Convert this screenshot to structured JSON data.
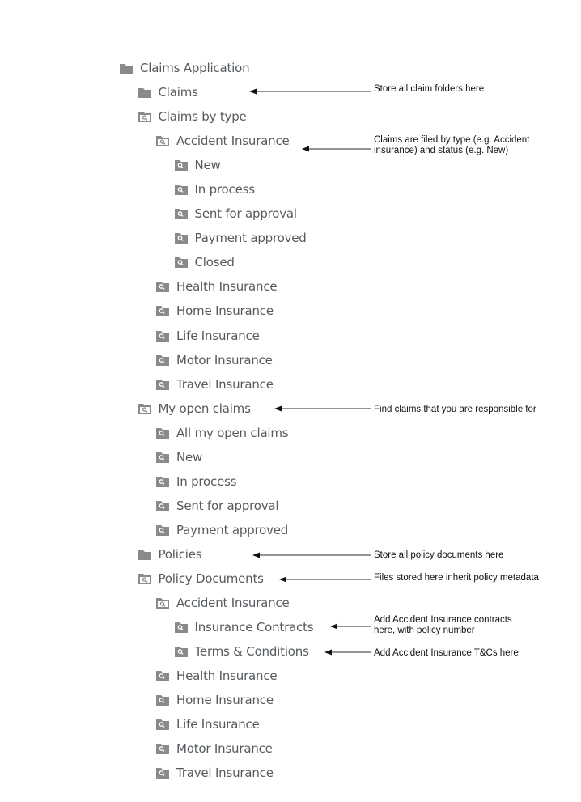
{
  "tree": {
    "root": {
      "label": "Claims Application",
      "icon": "folder-icon"
    },
    "items": [
      {
        "label": "Claims",
        "icon": "folder-icon"
      },
      {
        "label": "Claims by type",
        "icon": "open-search-folder-icon"
      },
      {
        "label": "Accident Insurance",
        "icon": "open-search-folder-icon"
      },
      {
        "label": "New",
        "icon": "search-folder-icon"
      },
      {
        "label": "In process",
        "icon": "search-folder-icon"
      },
      {
        "label": "Sent for approval",
        "icon": "search-folder-icon"
      },
      {
        "label": "Payment approved",
        "icon": "search-folder-icon"
      },
      {
        "label": "Closed",
        "icon": "search-folder-icon"
      },
      {
        "label": "Health Insurance",
        "icon": "search-folder-icon"
      },
      {
        "label": "Home Insurance",
        "icon": "search-folder-icon"
      },
      {
        "label": "Life Insurance",
        "icon": "search-folder-icon"
      },
      {
        "label": "Motor Insurance",
        "icon": "search-folder-icon"
      },
      {
        "label": "Travel Insurance",
        "icon": "search-folder-icon"
      },
      {
        "label": "My open claims",
        "icon": "open-search-folder-icon"
      },
      {
        "label": "All my open claims",
        "icon": "search-folder-icon"
      },
      {
        "label": "New",
        "icon": "search-folder-icon"
      },
      {
        "label": "In process",
        "icon": "search-folder-icon"
      },
      {
        "label": "Sent for approval",
        "icon": "search-folder-icon"
      },
      {
        "label": "Payment approved",
        "icon": "search-folder-icon"
      },
      {
        "label": "Policies",
        "icon": "folder-icon"
      },
      {
        "label": "Policy Documents",
        "icon": "open-search-folder-icon"
      },
      {
        "label": "Accident Insurance",
        "icon": "open-search-folder-icon"
      },
      {
        "label": "Insurance Contracts",
        "icon": "search-folder-icon"
      },
      {
        "label": "Terms & Conditions",
        "icon": "search-folder-icon"
      },
      {
        "label": "Health Insurance",
        "icon": "search-folder-icon"
      },
      {
        "label": "Home Insurance",
        "icon": "search-folder-icon"
      },
      {
        "label": "Life Insurance",
        "icon": "search-folder-icon"
      },
      {
        "label": "Motor Insurance",
        "icon": "search-folder-icon"
      },
      {
        "label": "Travel Insurance",
        "icon": "search-folder-icon"
      }
    ]
  },
  "annotations": [
    {
      "target": "Claims",
      "text": "Store all claim folders here"
    },
    {
      "target": "Accident Insurance",
      "text": "Claims are filed by type (e.g. Accident\ninsurance) and status (e.g. New)"
    },
    {
      "target": "My open claims",
      "text": "Find claims that you are responsible for"
    },
    {
      "target": "Policies",
      "text": "Store all policy documents here"
    },
    {
      "target": "Policy Documents",
      "text": "Files stored here inherit policy metadata"
    },
    {
      "target": "Insurance Contracts",
      "text": "Add Accident Insurance contracts\nhere, with policy number"
    },
    {
      "target": "Terms & Conditions",
      "text": "Add Accident Insurance T&Cs here"
    }
  ],
  "colors": {
    "icon": "#8a8a8a",
    "text": "#555a5e",
    "arrow": "#555555"
  }
}
